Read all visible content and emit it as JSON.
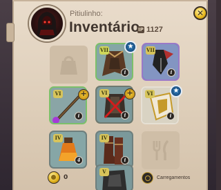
{
  "header": {
    "subtitle": "Pitiulinho:",
    "title": "Inventário",
    "level_badge": "IP",
    "level_value": "1127"
  },
  "slots": [
    {
      "name": "bag-slot",
      "empty": true,
      "icon": "bag-icon"
    },
    {
      "name": "head-slot",
      "empty": false,
      "tier": "VII",
      "item_icon": "cape-icon",
      "frame": "green",
      "badge": "star",
      "info": "i"
    },
    {
      "name": "cape-slot",
      "empty": false,
      "tier": "VII",
      "item_icon": "weapon-icon",
      "frame": "purple",
      "info": "i"
    },
    {
      "name": "main-hand-slot",
      "empty": false,
      "tier": "VI",
      "item_icon": "staff-icon",
      "frame": "green",
      "badge": "plus",
      "info": "i"
    },
    {
      "name": "armor-slot",
      "empty": false,
      "tier": "VI",
      "item_icon": "armor-icon",
      "frame": "none",
      "disabled": true,
      "badge": "plus",
      "info": "i"
    },
    {
      "name": "off-hand-slot",
      "empty": false,
      "tier": "VI",
      "item_icon": "shield-icon",
      "frame": "white",
      "badge": "star",
      "info": "i"
    },
    {
      "name": "potion-slot",
      "empty": false,
      "tier": "IV",
      "item_icon": "potion-icon",
      "frame": "none",
      "info": "4"
    },
    {
      "name": "shoes-slot",
      "empty": false,
      "tier": "IV",
      "item_icon": "boots-icon",
      "frame": "none",
      "info": "i"
    },
    {
      "name": "food-slot",
      "empty": true,
      "icon": "fork-knife-icon"
    },
    {
      "name": "mount-slot",
      "empty": false,
      "tier": "V",
      "item_icon": "mount-icon",
      "frame": "none"
    }
  ],
  "footer": {
    "coins": "0",
    "cargo_label": "Carregamentos"
  },
  "colors": {
    "panel_bg": "#e9dccb",
    "gold": "#e8b81e",
    "frame_green": "#7cc06a",
    "frame_purple": "#9a79c8"
  }
}
